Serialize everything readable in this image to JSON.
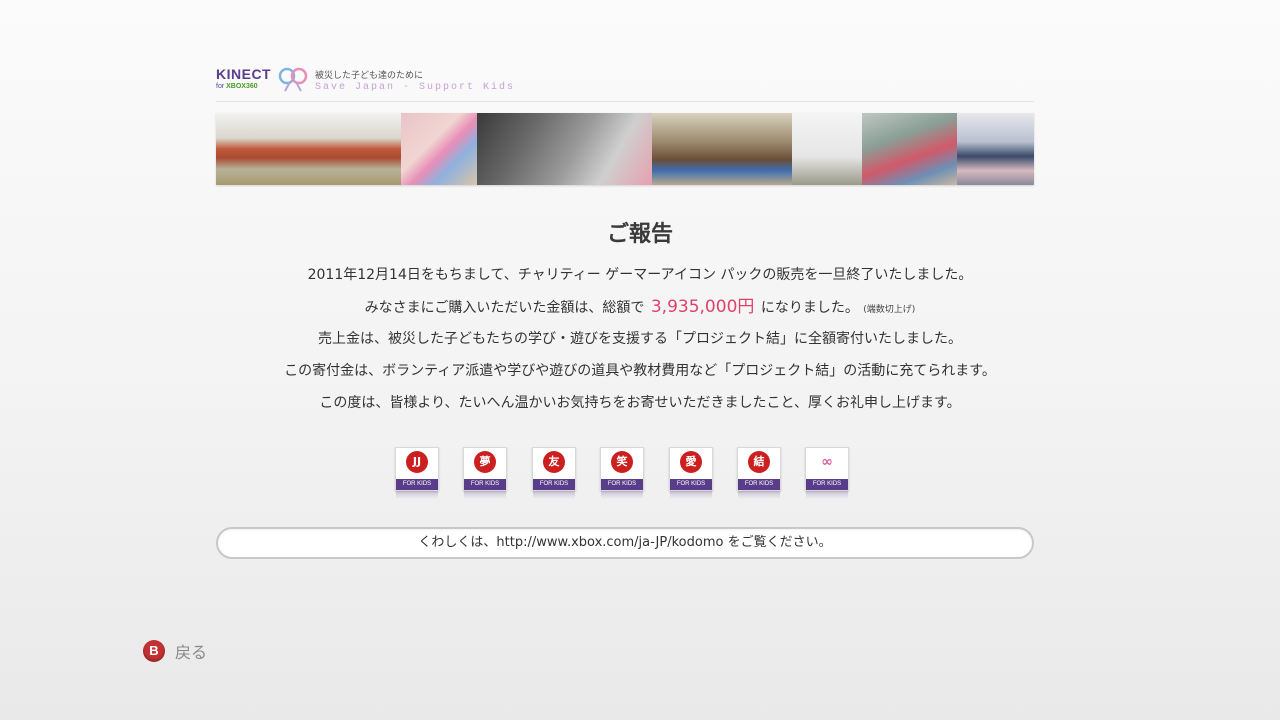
{
  "header": {
    "kinect_label": "KINECT",
    "for_label": "for",
    "xbox_label": "XBOX360",
    "subtitle_jp": "被災した子ども達のために",
    "subtitle_en": "Save Japan - Support Kids"
  },
  "report": {
    "title": "ご報告",
    "line1": "2011年12月14日をもちまして、チャリティー ゲーマーアイコン パックの販売を一旦終了いたしました。",
    "line2_prefix": "みなさまにご購入いただいた金額は、総額で",
    "line2_amount": "3,935,000円",
    "line2_suffix": "になりました。",
    "line2_note": "(端数切上げ)",
    "line3": "売上金は、被災した子どもたちの学び・遊びを支援する「プロジェクト結」に全額寄付いたしました。",
    "line4": "この寄付金は、ボランティア派遣や学びや遊びの道具や教材費用など「プロジェクト結」の活動に充てられます。",
    "line5": "この度は、皆様より、たいへん温かいお気持ちをお寄せいただきましたこと、厚くお礼申し上げます。"
  },
  "icons": [
    {
      "glyph": "JJ",
      "label": "FOR KIDS"
    },
    {
      "glyph": "夢",
      "label": "FOR KIDS"
    },
    {
      "glyph": "友",
      "label": "FOR KIDS"
    },
    {
      "glyph": "笑",
      "label": "FOR KIDS"
    },
    {
      "glyph": "愛",
      "label": "FOR KIDS"
    },
    {
      "glyph": "結",
      "label": "FOR KIDS"
    },
    {
      "glyph": "∞",
      "label": "FOR KIDS"
    }
  ],
  "url_bar": {
    "text": "くわしくは、http://www.xbox.com/ja-JP/kodomo をご覧ください。"
  },
  "controls": {
    "back_button_glyph": "B",
    "back_label": "戻る"
  },
  "colors": {
    "accent_purple": "#5b3d8d",
    "amount_pink": "#e0416c",
    "icon_red": "#cc1f1f",
    "b_button_red": "#c23232"
  }
}
